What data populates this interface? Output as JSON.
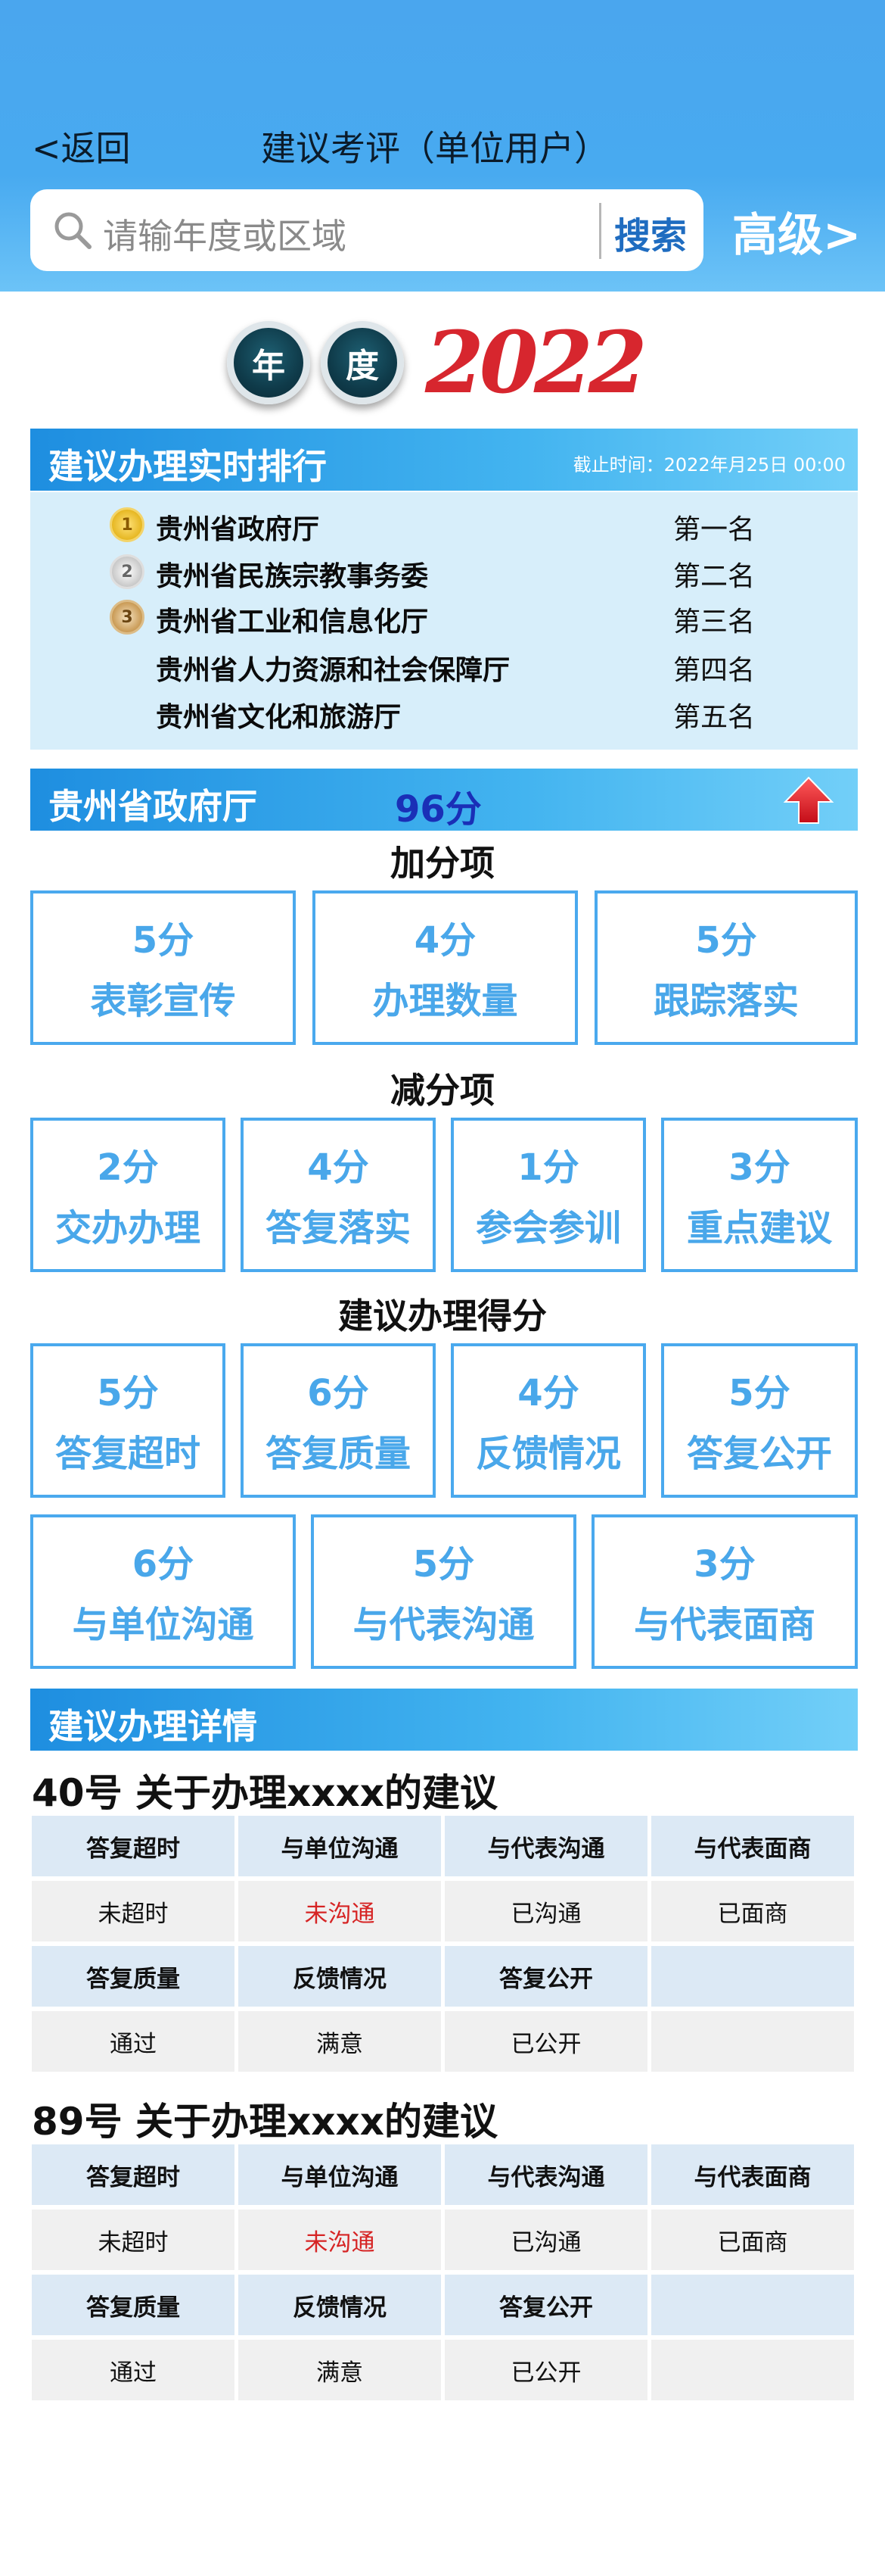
{
  "header": {
    "back_label": "<返回",
    "title": "建议考评（单位用户）",
    "search_placeholder": "请输年度或区域",
    "search_button": "搜索",
    "advanced_label": "高级>"
  },
  "year_badge": {
    "char1": "年",
    "char2": "度",
    "year": "2022"
  },
  "ranking": {
    "title": "建议办理实时排行",
    "deadline": "截止时间：2022年月25日  00:00",
    "items": [
      {
        "name": "贵州省政府厅",
        "position": "第一名",
        "medal": "1"
      },
      {
        "name": "贵州省民族宗教事务委",
        "position": "第二名",
        "medal": "2"
      },
      {
        "name": "贵州省工业和信息化厅",
        "position": "第三名",
        "medal": "3"
      },
      {
        "name": "贵州省人力资源和社会保障厅",
        "position": "第四名",
        "medal": ""
      },
      {
        "name": "贵州省文化和旅游厅",
        "position": "第五名",
        "medal": ""
      }
    ]
  },
  "unit": {
    "name": "贵州省政府厅",
    "score": "96分"
  },
  "bonus": {
    "heading": "加分项",
    "items": [
      {
        "points": "5分",
        "label": "表彰宣传"
      },
      {
        "points": "4分",
        "label": "办理数量"
      },
      {
        "points": "5分",
        "label": "跟踪落实"
      }
    ]
  },
  "deduct": {
    "heading": "减分项",
    "items": [
      {
        "points": "2分",
        "label": "交办办理"
      },
      {
        "points": "4分",
        "label": "答复落实"
      },
      {
        "points": "1分",
        "label": "参会参训"
      },
      {
        "points": "3分",
        "label": "重点建议"
      }
    ]
  },
  "handling": {
    "heading": "建议办理得分",
    "row1": [
      {
        "points": "5分",
        "label": "答复超时"
      },
      {
        "points": "6分",
        "label": "答复质量"
      },
      {
        "points": "4分",
        "label": "反馈情况"
      },
      {
        "points": "5分",
        "label": "答复公开"
      }
    ],
    "row2": [
      {
        "points": "6分",
        "label": "与单位沟通"
      },
      {
        "points": "5分",
        "label": "与代表沟通"
      },
      {
        "points": "3分",
        "label": "与代表面商"
      }
    ]
  },
  "details": {
    "title": "建议办理详情",
    "suggestions": [
      {
        "title": "40号    关于办理xxxx的建议",
        "headers1": [
          "答复超时",
          "与单位沟通",
          "与代表沟通",
          "与代表面商"
        ],
        "values1": [
          "未超时",
          "未沟通",
          "已沟通",
          "已面商"
        ],
        "headers2": [
          "答复质量",
          "反馈情况",
          "答复公开",
          ""
        ],
        "values2": [
          "通过",
          "满意",
          "已公开",
          ""
        ]
      },
      {
        "title": "89号    关于办理xxxx的建议",
        "headers1": [
          "答复超时",
          "与单位沟通",
          "与代表沟通",
          "与代表面商"
        ],
        "values1": [
          "未超时",
          "未沟通",
          "已沟通",
          "已面商"
        ],
        "headers2": [
          "答复质量",
          "反馈情况",
          "答复公开",
          ""
        ],
        "values2": [
          "通过",
          "满意",
          "已公开",
          ""
        ]
      }
    ]
  },
  "colors": {
    "header_blue": "#48aaf0",
    "accent_blue": "#49a7ea",
    "warning_red": "#d62424"
  }
}
